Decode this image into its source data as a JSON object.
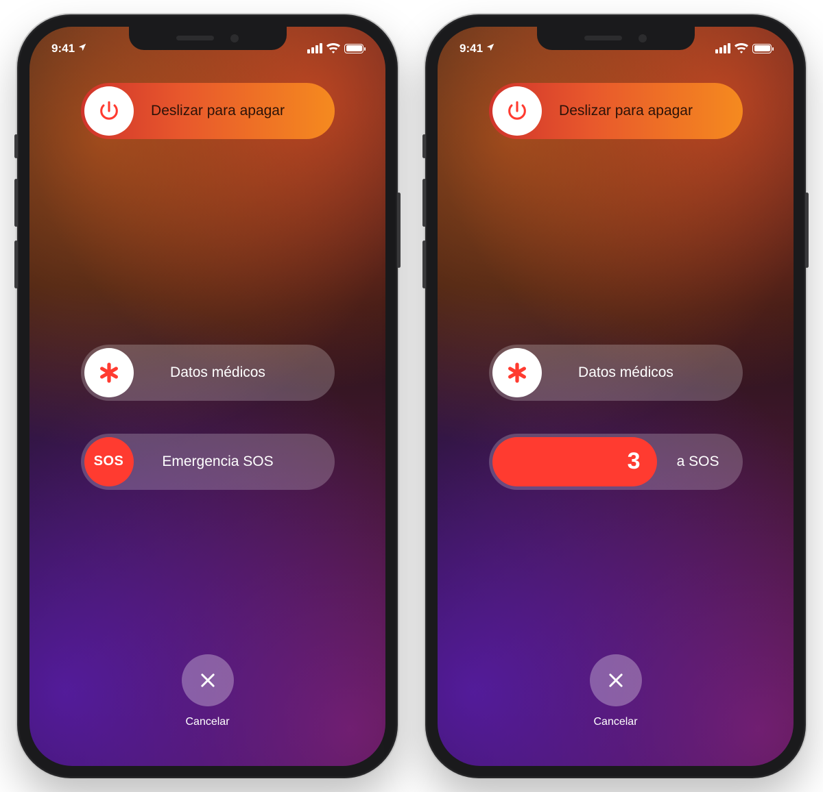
{
  "status": {
    "time": "9:41"
  },
  "sliders": {
    "power_off": "Deslizar para apagar",
    "medical": "Datos médicos",
    "sos": "Emergencia SOS",
    "sos_knob": "SOS"
  },
  "phone2": {
    "sos_countdown": "3",
    "sos_trail": "a SOS"
  },
  "cancel": {
    "label": "Cancelar"
  },
  "colors": {
    "sos_red": "#ff3b30",
    "power_gradient_start": "#d0342b",
    "power_gradient_end": "#f58a1f"
  }
}
